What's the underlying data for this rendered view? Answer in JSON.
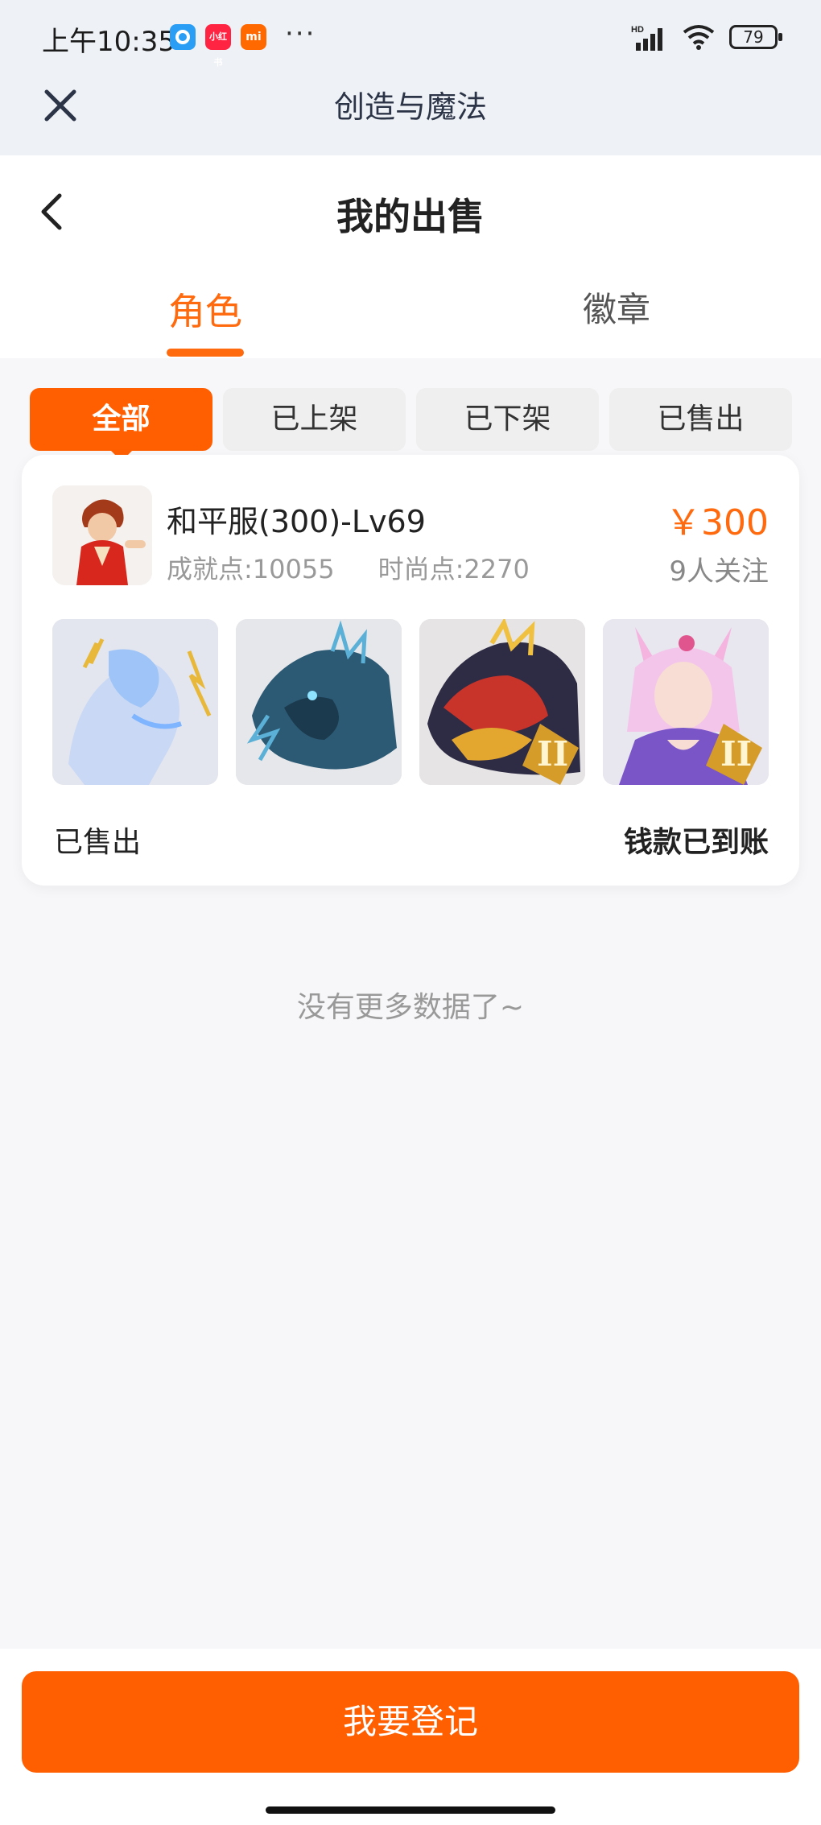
{
  "status_bar": {
    "time": "上午10:35",
    "apps": [
      "blue-app-icon",
      "xiaohongshu-icon",
      "mi-icon"
    ],
    "xiaohongshu_label": "小红书",
    "mi_label": "mi",
    "more": "···",
    "network_label": "HD",
    "battery": "79"
  },
  "app_header": {
    "title": "创造与魔法"
  },
  "page": {
    "title": "我的出售"
  },
  "tabs": [
    {
      "label": "角色",
      "active": true
    },
    {
      "label": "徽章",
      "active": false
    }
  ],
  "filters": [
    {
      "label": "全部",
      "active": true
    },
    {
      "label": "已上架",
      "active": false
    },
    {
      "label": "已下架",
      "active": false
    },
    {
      "label": "已售出",
      "active": false
    }
  ],
  "listing": {
    "name": "和平服(300)-Lv69",
    "achievement": "成就点:10055",
    "fashion": "时尚点:2270",
    "price": "￥300",
    "followers": "9人关注",
    "thumbnails": [
      "thunder-horse-mount",
      "ice-dragon-mount",
      "golden-dragon-mount",
      "fox-girl-outfit"
    ],
    "status": "已售出",
    "payment_status": "钱款已到账"
  },
  "no_more_text": "没有更多数据了~",
  "footer": {
    "register_label": "我要登记"
  },
  "colors": {
    "accent": "#ff5f00",
    "tab_active": "#ff6a0e",
    "background": "#f7f7f9"
  }
}
